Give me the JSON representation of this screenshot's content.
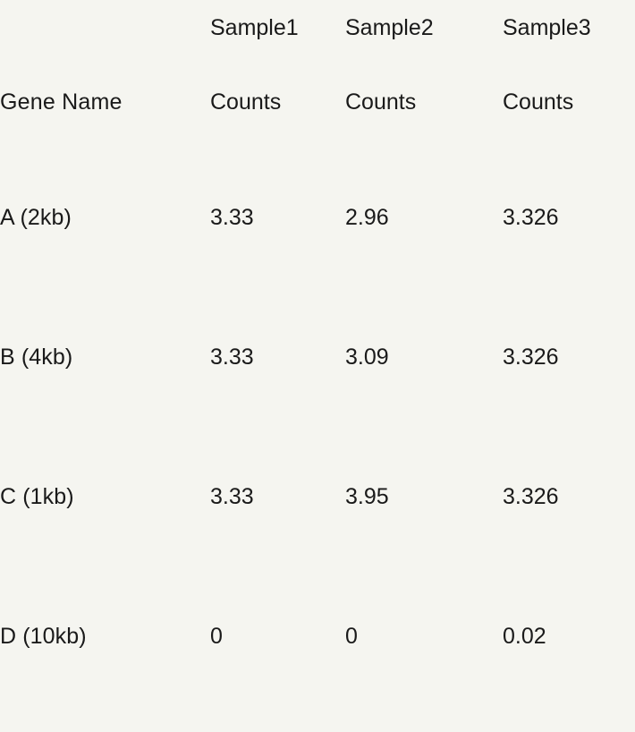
{
  "table": {
    "row_header_label": "Gene Name",
    "sample_headers": [
      "Sample1",
      "Sample2",
      "Sample3"
    ],
    "unit_headers": [
      "Counts",
      "Counts",
      "Counts"
    ],
    "rows": [
      {
        "gene": "A (2kb)",
        "counts": [
          "3.33",
          "2.96",
          "3.326"
        ]
      },
      {
        "gene": "B (4kb)",
        "counts": [
          "3.33",
          "3.09",
          "3.326"
        ]
      },
      {
        "gene": "C (1kb)",
        "counts": [
          "3.33",
          "3.95",
          "3.326"
        ]
      },
      {
        "gene": "D (10kb)",
        "counts": [
          "0",
          "0",
          "0.02"
        ]
      }
    ]
  },
  "chart_data": {
    "type": "table",
    "title": "",
    "columns": [
      "Gene Name",
      "Sample1 Counts",
      "Sample2 Counts",
      "Sample3 Counts"
    ],
    "categories": [
      "A (2kb)",
      "B (4kb)",
      "C (1kb)",
      "D (10kb)"
    ],
    "series": [
      {
        "name": "Sample1 Counts",
        "values": [
          3.33,
          3.33,
          3.33,
          0
        ]
      },
      {
        "name": "Sample2 Counts",
        "values": [
          2.96,
          3.09,
          3.95,
          0
        ]
      },
      {
        "name": "Sample3 Counts",
        "values": [
          3.326,
          3.326,
          3.326,
          0.02
        ]
      }
    ],
    "xlabel": "Gene Name",
    "ylabel": "Counts",
    "grid": false,
    "legend": "none"
  },
  "style": {
    "background": "#F5F5F0",
    "text_color": "#1a1a1a"
  }
}
